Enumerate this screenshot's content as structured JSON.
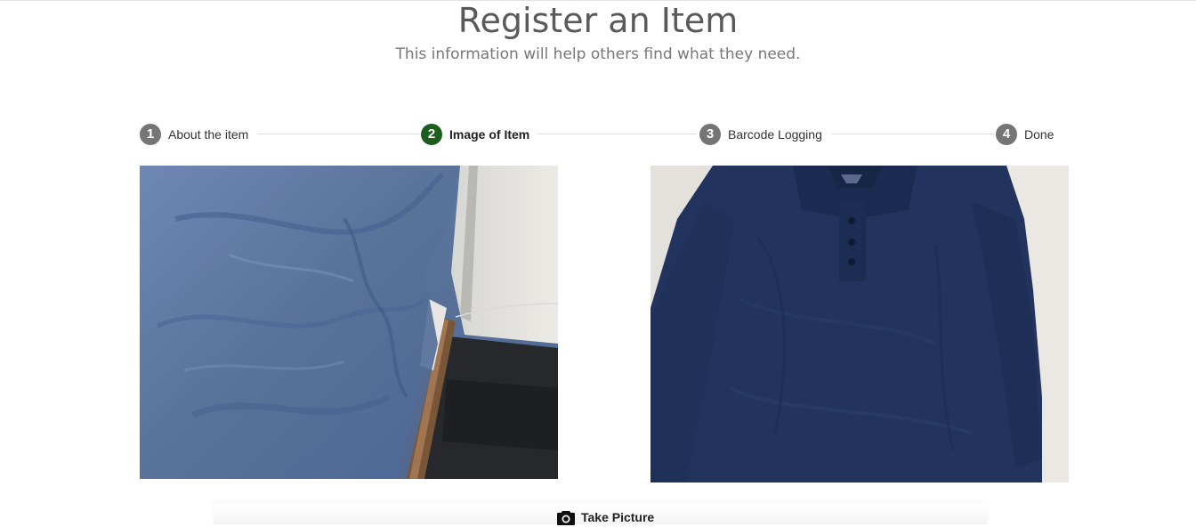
{
  "header": {
    "title": "Register an Item",
    "subtitle": "This information will help others find what they need."
  },
  "stepper": {
    "steps": [
      {
        "number": "1",
        "label": "About the item",
        "active": false
      },
      {
        "number": "2",
        "label": "Image of Item",
        "active": true
      },
      {
        "number": "3",
        "label": "Barcode Logging",
        "active": false
      },
      {
        "number": "4",
        "label": "Done",
        "active": false
      }
    ],
    "active_color": "#1b5e20",
    "inactive_color": "#757575"
  },
  "images": [
    {
      "description_icon": "photo-captured"
    },
    {
      "description_icon": "photo-preview"
    }
  ],
  "actions": {
    "take_picture_label": "Take Picture",
    "take_picture_icon": "camera-icon"
  }
}
